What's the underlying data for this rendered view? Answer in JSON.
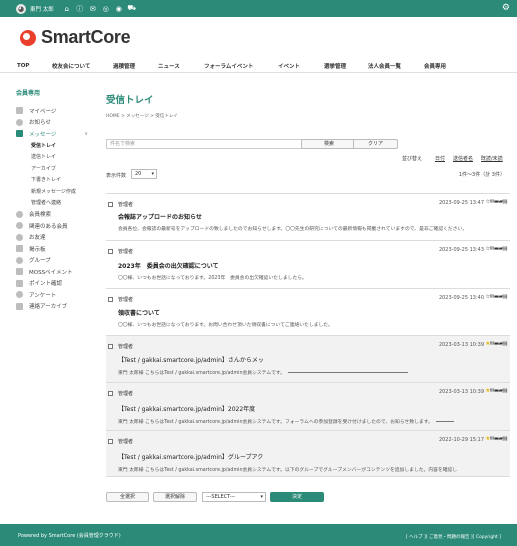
{
  "topbar": {
    "user_name": "東門 太郎"
  },
  "logo": {
    "text": "SmartCore"
  },
  "global_nav": [
    "TOP",
    "校友会について",
    "過積管理",
    "ニュース",
    "フォーラムイベント",
    "イベント",
    "選挙管理",
    "法人会員一覧",
    "会員専用"
  ],
  "sidebar": {
    "heading": "会員専用",
    "items": [
      {
        "label": "マイページ"
      },
      {
        "label": "お知らせ"
      },
      {
        "label": "メッセージ"
      },
      {
        "label": "受信トレイ"
      },
      {
        "label": "送信トレイ"
      },
      {
        "label": "アーカイブ"
      },
      {
        "label": "下書きトレイ"
      },
      {
        "label": "新規メッセージ作成"
      },
      {
        "label": "管理者へ連絡"
      },
      {
        "label": "会員検索"
      },
      {
        "label": "関連のある会員"
      },
      {
        "label": "お友達"
      },
      {
        "label": "掲示板"
      },
      {
        "label": "グループ"
      },
      {
        "label": "MOSSペイメント"
      },
      {
        "label": "ポイント確認"
      },
      {
        "label": "アンケート"
      },
      {
        "label": "連絡アーカイブ"
      }
    ]
  },
  "page": {
    "title": "受信トレイ",
    "breadcrumb": "HOME > メッセージ > 受信トレイ",
    "search_placeholder": "件名で検索",
    "search_button": "検索",
    "clear_button": "クリア",
    "sort_links": [
      "並び替え",
      "日付",
      "送信者名",
      "既読/未読"
    ],
    "per_page_label": "表示件数",
    "per_page_value": "20",
    "count_text": "1件～3件（計 3件）"
  },
  "messages": [
    {
      "sender": "管理者",
      "date": "2023-09-25 13:47",
      "subject": "会報誌アップロードのお知らせ",
      "body": "会員各位、会報誌の最新号をアップロードの致しましたのでお知らせします。〇〇先生の研究についての最新情報も掲載されていますので、是非ご確認ください。",
      "starred": false
    },
    {
      "sender": "管理者",
      "date": "2023-09-25 13:43",
      "subject": "2023年　委員会の出欠確認について",
      "body": "〇〇様、いつもお世話になっております。2023年　委員会の出欠確認いたしましたら。",
      "starred": false
    },
    {
      "sender": "管理者",
      "date": "2023-09-25 13:40",
      "subject": "領収書について",
      "body": "〇〇様、いつもお世話になっております。お問い合わせ頂いた領収書についてご連絡いたしました。",
      "starred": false
    },
    {
      "sender": "管理者",
      "date": "2023-03-13 10:39",
      "subject": "【Test / gakkai.smartcore.jp/admin】さんからメッ",
      "body": "東門 太郎様 こちらはTest / gakkai.smartcore.jp/admin会員システムです。",
      "starred": true
    },
    {
      "sender": "管理者",
      "date": "2023-03-13 10:39",
      "subject": "【Test / gakkai.smartcore.jp/admin】2022年度",
      "body": "東門 太郎様 こちらはTest / gakkai.smartcore.jp/admin会員システムです。フォーラムへの参加登録を受け付けましたので、お知らせ致します。",
      "starred": true
    },
    {
      "sender": "管理者",
      "date": "2022-10-29 15:17",
      "subject": "【Test / gakkai.smartcore.jp/admin】グループアク",
      "body": "東門 太郎様 こちらはTest / gakkai.smartcore.jp/admin会員システムです。以下のグループでグループメンバーがコンテンツを追加しました。内容を確認し",
      "starred": true
    }
  ],
  "bottom": {
    "select_all": "全選択",
    "deselect": "選択解除",
    "action_select": "---SELECT---",
    "go_button": "決定"
  },
  "footer": {
    "powered": "Powered by SmartCore (会員管理クラウド)",
    "links": "[ ヘルプ ][ ご意見・問題の報告 ][ Copyright ]"
  },
  "colors": {
    "brand": "#2b8a78",
    "logo_red": "#e8402d"
  }
}
